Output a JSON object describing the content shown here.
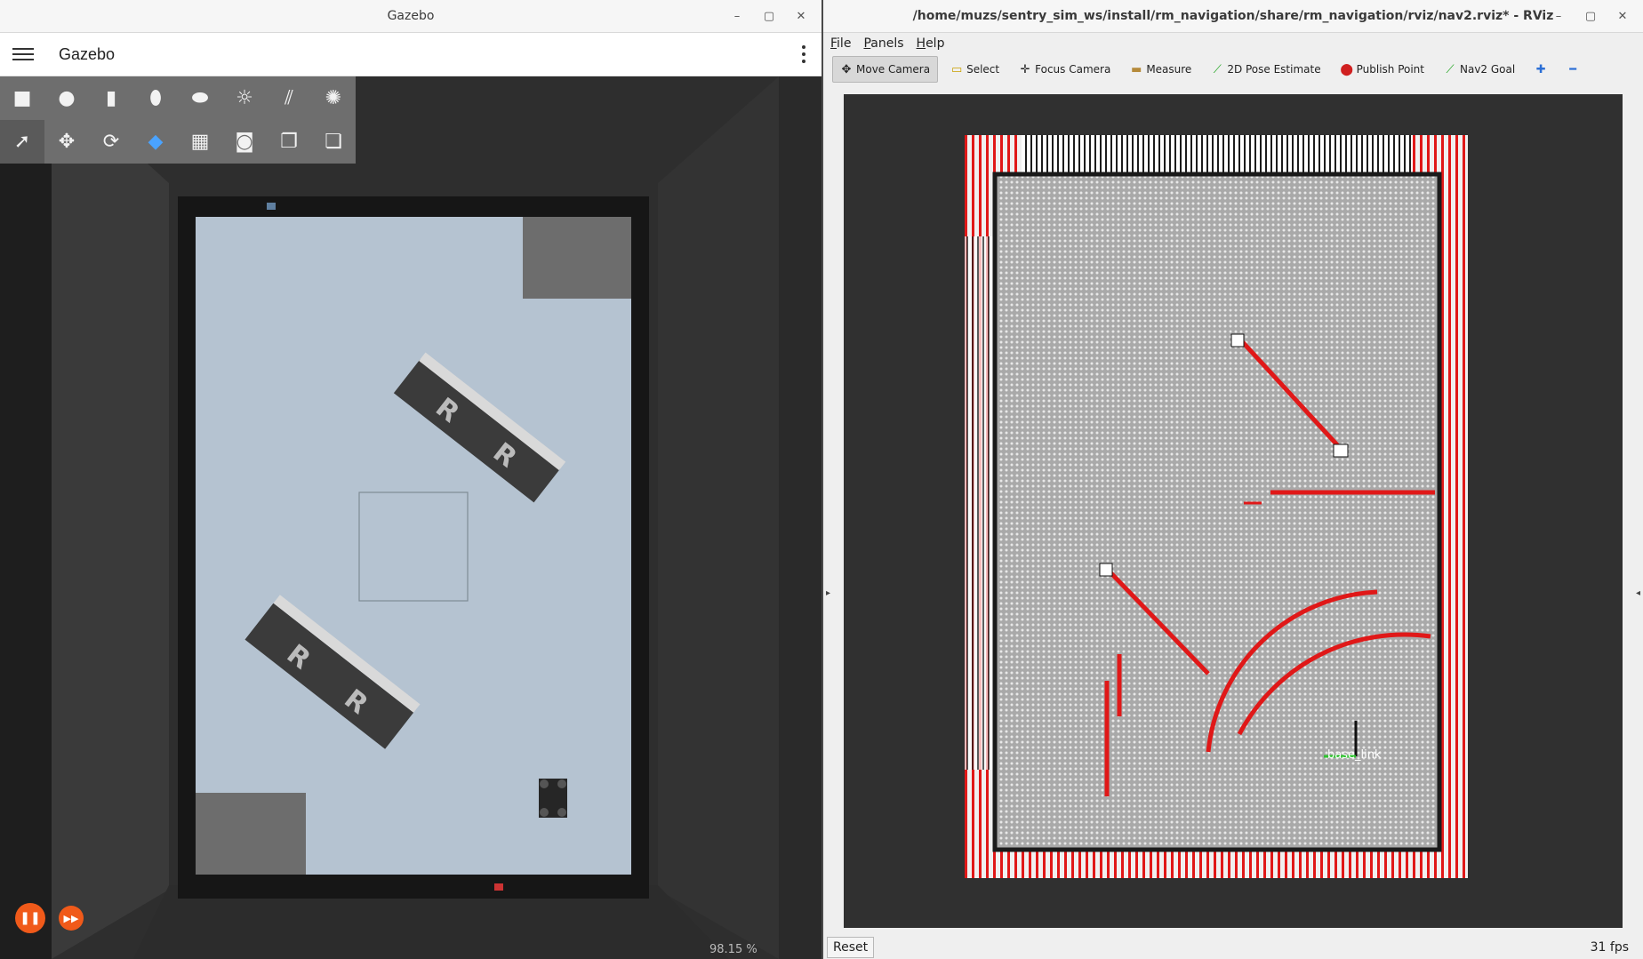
{
  "gazebo": {
    "window_title": "Gazebo",
    "app_title": "Gazebo",
    "toolbar_row1": [
      "box-icon",
      "sphere-icon",
      "cylinder-icon",
      "capsule-icon",
      "ellipsoid-icon",
      "sun-light-icon",
      "directional-light-icon",
      "spot-light-icon"
    ],
    "toolbar_row2": [
      "select-arrow-icon",
      "translate-icon",
      "rotate-icon",
      "align-icon",
      "grid-snap-icon",
      "screenshot-camera-icon",
      "copy-icon",
      "paste-icon"
    ],
    "zoom": "98.15 %",
    "play_colors": {
      "accent": "#f05a1a"
    }
  },
  "rviz": {
    "window_title": "/home/muzs/sentry_sim_ws/install/rm_navigation/share/rm_navigation/rviz/nav2.rviz* - RViz",
    "menu": [
      "File",
      "Panels",
      "Help"
    ],
    "tools": [
      {
        "label": "Move Camera",
        "icon": "move-camera-icon"
      },
      {
        "label": "Select",
        "icon": "select-icon"
      },
      {
        "label": "Focus Camera",
        "icon": "focus-camera-icon"
      },
      {
        "label": "Measure",
        "icon": "measure-icon"
      },
      {
        "label": "2D Pose Estimate",
        "icon": "pose-estimate-icon"
      },
      {
        "label": "Publish Point",
        "icon": "publish-point-icon"
      },
      {
        "label": "Nav2 Goal",
        "icon": "nav2-goal-icon"
      }
    ],
    "frame_label": "base_link",
    "reset_label": "Reset",
    "fps": "31 fps",
    "colors": {
      "laser": "#e01818",
      "map_cell": "#bdbdbd",
      "bg": "#303030"
    }
  }
}
